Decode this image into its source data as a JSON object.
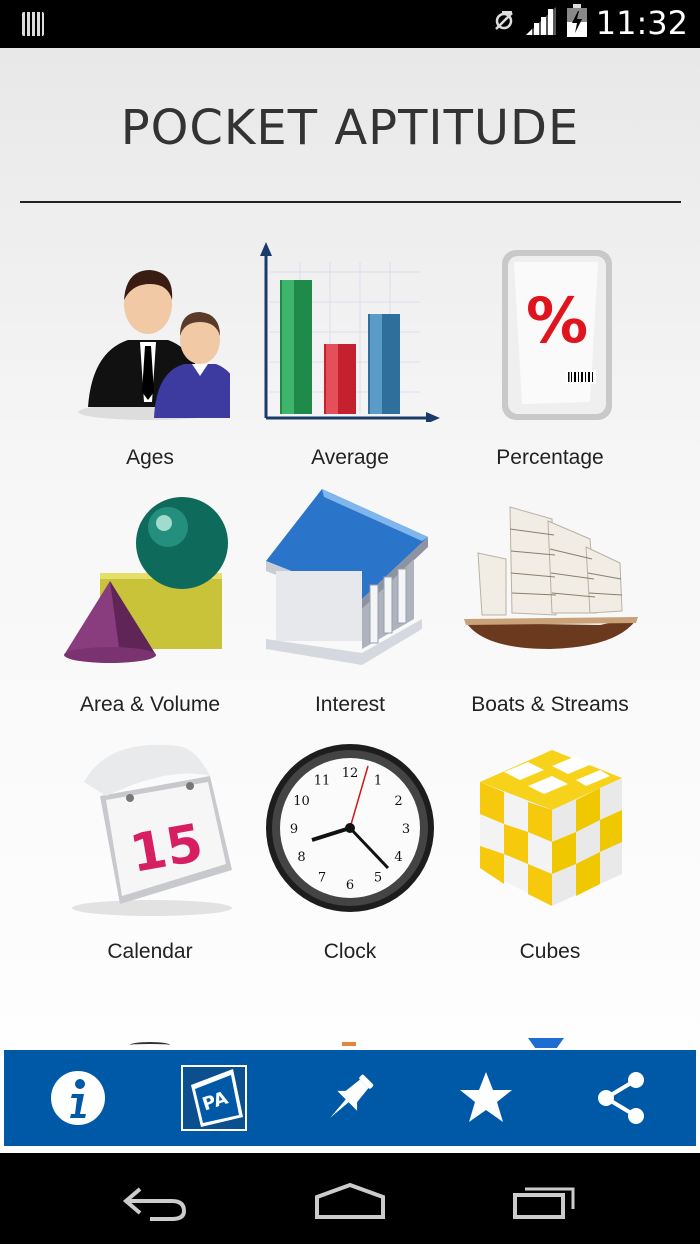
{
  "status_bar": {
    "time": "11:32"
  },
  "app": {
    "title": "POCKET APTITUDE"
  },
  "topics": [
    {
      "label": "Ages",
      "icon": "people-icon"
    },
    {
      "label": "Average",
      "icon": "bar-chart-icon"
    },
    {
      "label": "Percentage",
      "icon": "percentage-icon"
    },
    {
      "label": "Area & Volume",
      "icon": "shapes-icon"
    },
    {
      "label": "Interest",
      "icon": "bank-icon"
    },
    {
      "label": "Boats & Streams",
      "icon": "ship-icon"
    },
    {
      "label": "Calendar",
      "icon": "calendar-icon"
    },
    {
      "label": "Clock",
      "icon": "clock-icon"
    },
    {
      "label": "Cubes",
      "icon": "cube-icon"
    }
  ],
  "calendar_day": "15",
  "clock_numbers": [
    "12",
    "1",
    "2",
    "3",
    "4",
    "5",
    "6",
    "7",
    "8",
    "9",
    "10",
    "11"
  ],
  "toolbar": {
    "info": "info-icon",
    "pa_logo": "PA",
    "pin": "pin-icon",
    "star": "star-icon",
    "share": "share-icon",
    "color": "#0059a6"
  },
  "navbar": {
    "back": "back-icon",
    "home": "home-icon",
    "recents": "recents-icon"
  }
}
